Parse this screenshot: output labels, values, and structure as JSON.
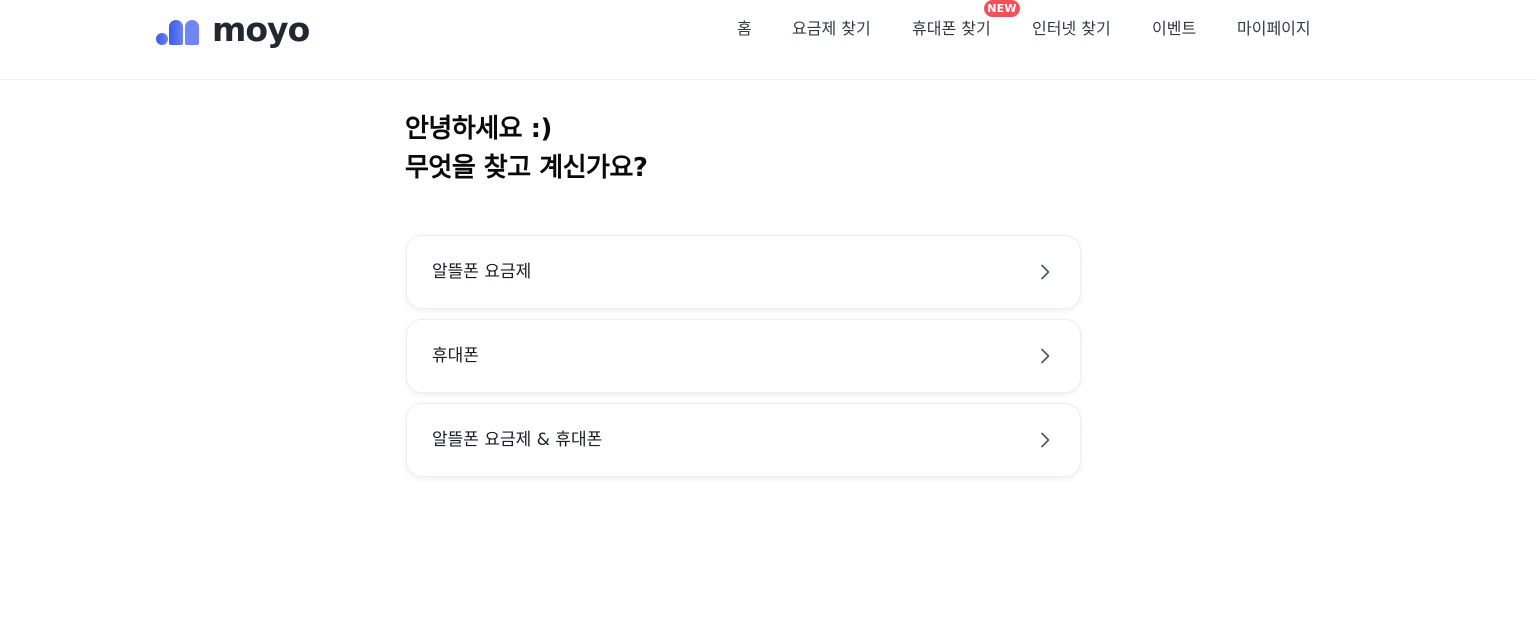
{
  "brand": {
    "logo_text": "moyo",
    "logo_color": "#4f6bec"
  },
  "nav": {
    "items": [
      {
        "label": "홈"
      },
      {
        "label": "요금제 찾기"
      },
      {
        "label": "휴대폰 찾기",
        "badge": "NEW"
      },
      {
        "label": "인터넷 찾기"
      },
      {
        "label": "이벤트"
      },
      {
        "label": "마이페이지"
      }
    ],
    "badge_color": "#f0525b"
  },
  "main": {
    "greeting_line1": "안녕하세요 :)",
    "greeting_line2": "무엇을 찾고 계신가요?",
    "options": [
      {
        "label": "알뜰폰 요금제",
        "icon": "chevron-right-icon"
      },
      {
        "label": "휴대폰",
        "icon": "chevron-right-icon"
      },
      {
        "label": "알뜰폰 요금제 & 휴대폰",
        "icon": "chevron-right-icon"
      }
    ]
  }
}
